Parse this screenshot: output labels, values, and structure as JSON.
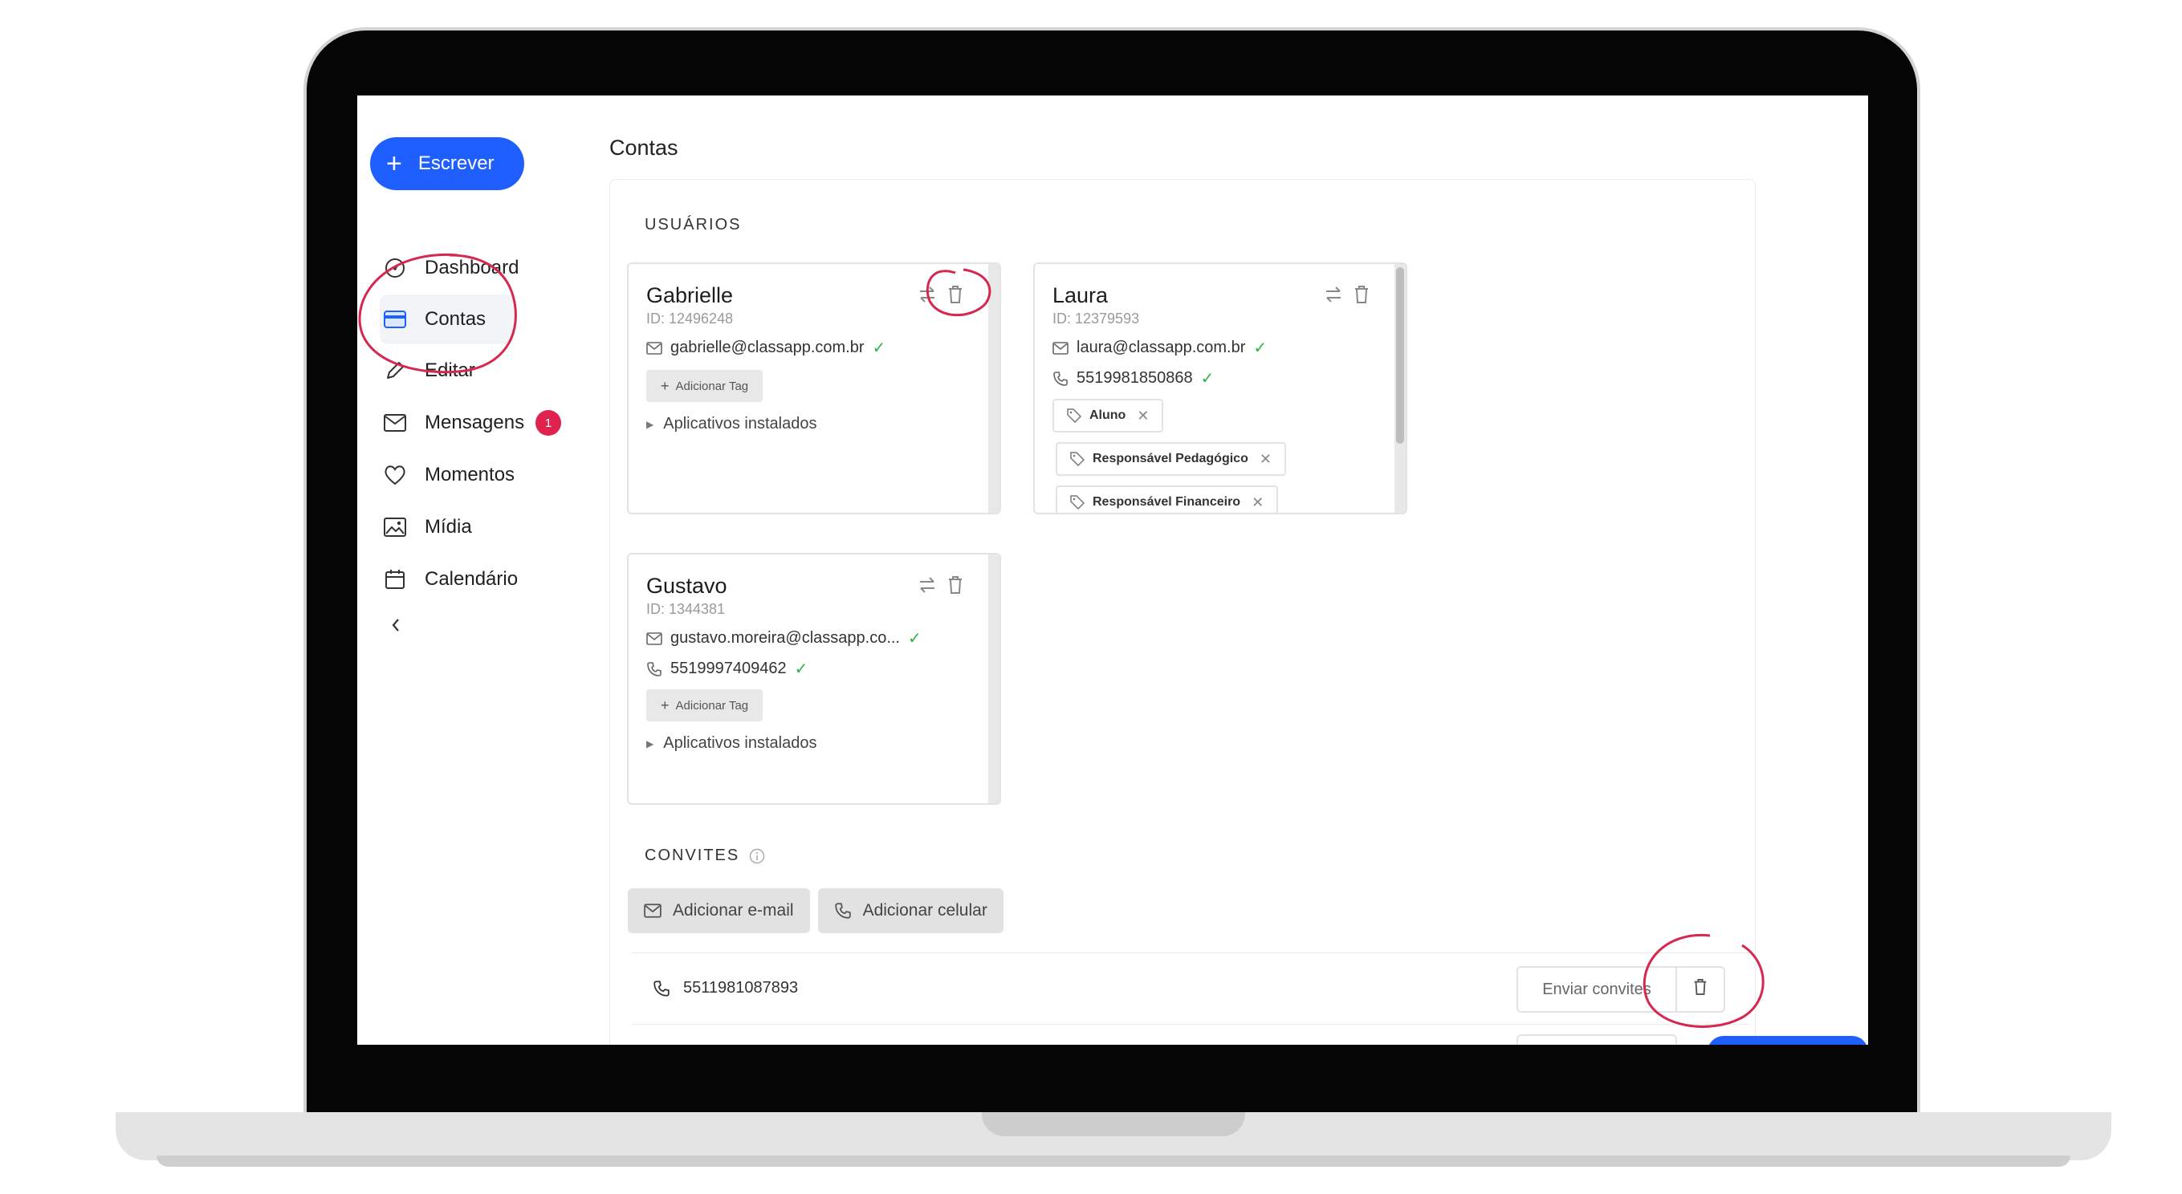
{
  "sidebar": {
    "compose_label": "Escrever",
    "items": [
      {
        "label": "Dashboard",
        "icon": "dashboard-gauge-icon"
      },
      {
        "label": "Contas",
        "icon": "accounts-card-icon",
        "active": true
      },
      {
        "label": "Editar",
        "icon": "pencil-icon"
      },
      {
        "label": "Mensagens",
        "icon": "envelope-icon",
        "badge": "1"
      },
      {
        "label": "Momentos",
        "icon": "heart-icon"
      },
      {
        "label": "Mídia",
        "icon": "image-icon"
      },
      {
        "label": "Calendário",
        "icon": "calendar-icon"
      }
    ],
    "collapse_icon": "chevron-left-icon"
  },
  "page": {
    "title": "Contas",
    "users_title": "USUÁRIOS",
    "invites_title": "CONVITES"
  },
  "users": [
    {
      "name": "Gabrielle",
      "id": "ID: 12496248",
      "email": "gabrielle@classapp.com.br",
      "add_tag": "Adicionar Tag",
      "apps": "Aplicativos instalados"
    },
    {
      "name": "Laura",
      "id": "ID: 12379593",
      "email": "laura@classapp.com.br",
      "phone": "5519981850868",
      "tags": [
        "Aluno",
        "Responsável Pedagógico",
        "Responsável Financeiro"
      ]
    },
    {
      "name": "Gustavo",
      "id": "ID: 1344381",
      "email": "gustavo.moreira@classapp.co...",
      "phone": "5519997409462",
      "add_tag": "Adicionar Tag",
      "apps": "Aplicativos instalados"
    }
  ],
  "invites": {
    "add_email": "Adicionar e-mail",
    "add_phone": "Adicionar celular",
    "rows": [
      {
        "phone": "5511981087893",
        "send_label": "Enviar convites"
      }
    ]
  },
  "colors": {
    "accent": "#1f5fff",
    "badge": "#e0234e",
    "check": "#2db34a",
    "annotation": "#d6284e"
  }
}
